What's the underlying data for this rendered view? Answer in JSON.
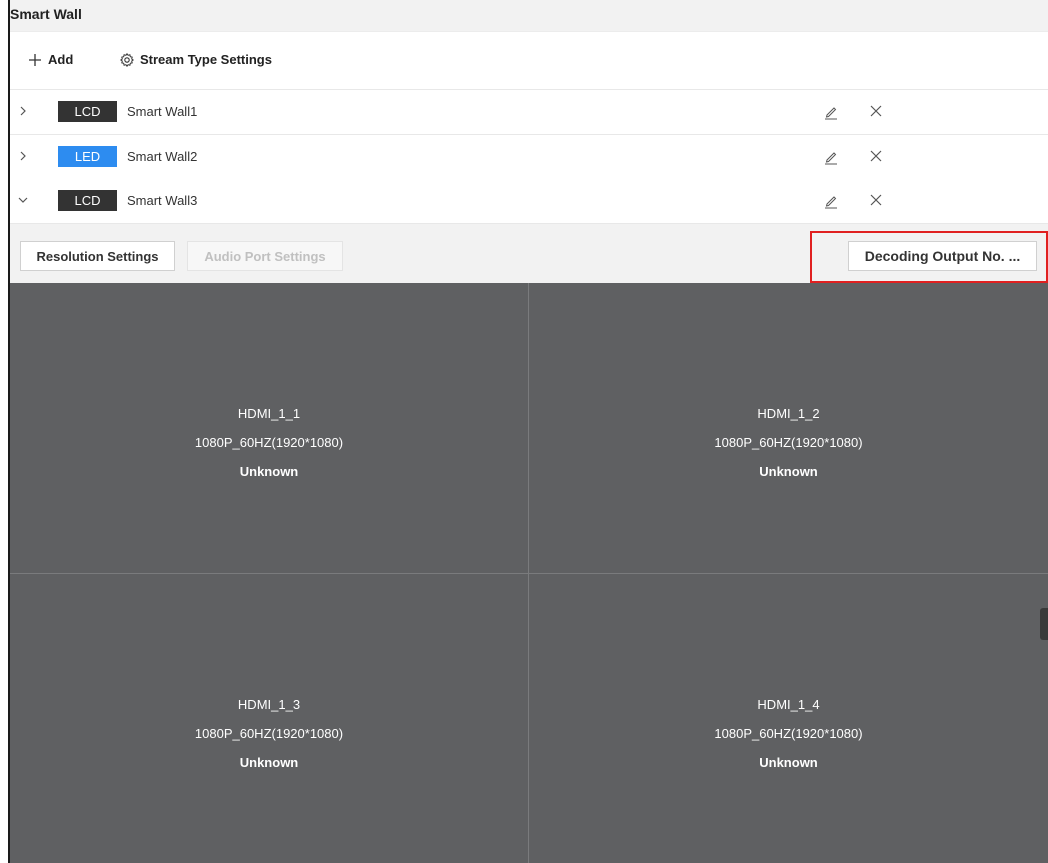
{
  "app": {
    "title": "Smart Wall"
  },
  "toolbar": {
    "add_label": "Add",
    "stream_label": "Stream Type Settings"
  },
  "walls": [
    {
      "type": "LCD",
      "type_color": "#333333",
      "name": "Smart Wall1",
      "expanded": false
    },
    {
      "type": "LED",
      "type_color": "#2d8cf0",
      "name": "Smart Wall2",
      "expanded": false
    },
    {
      "type": "LCD",
      "type_color": "#333333",
      "name": "Smart Wall3",
      "expanded": true
    }
  ],
  "actions": {
    "resolution_label": "Resolution Settings",
    "audio_label": "Audio Port Settings",
    "decoding_label": "Decoding Output No. ..."
  },
  "screens": [
    {
      "name": "HDMI_1_1",
      "resolution": "1080P_60HZ(1920*1080)",
      "status": "Unknown"
    },
    {
      "name": "HDMI_1_2",
      "resolution": "1080P_60HZ(1920*1080)",
      "status": "Unknown"
    },
    {
      "name": "HDMI_1_3",
      "resolution": "1080P_60HZ(1920*1080)",
      "status": "Unknown"
    },
    {
      "name": "HDMI_1_4",
      "resolution": "1080P_60HZ(1920*1080)",
      "status": "Unknown"
    }
  ],
  "colors": {
    "grid_bg": "#5f6062",
    "highlight": "#e02020",
    "led_badge": "#2d8cf0",
    "lcd_badge": "#333333"
  }
}
